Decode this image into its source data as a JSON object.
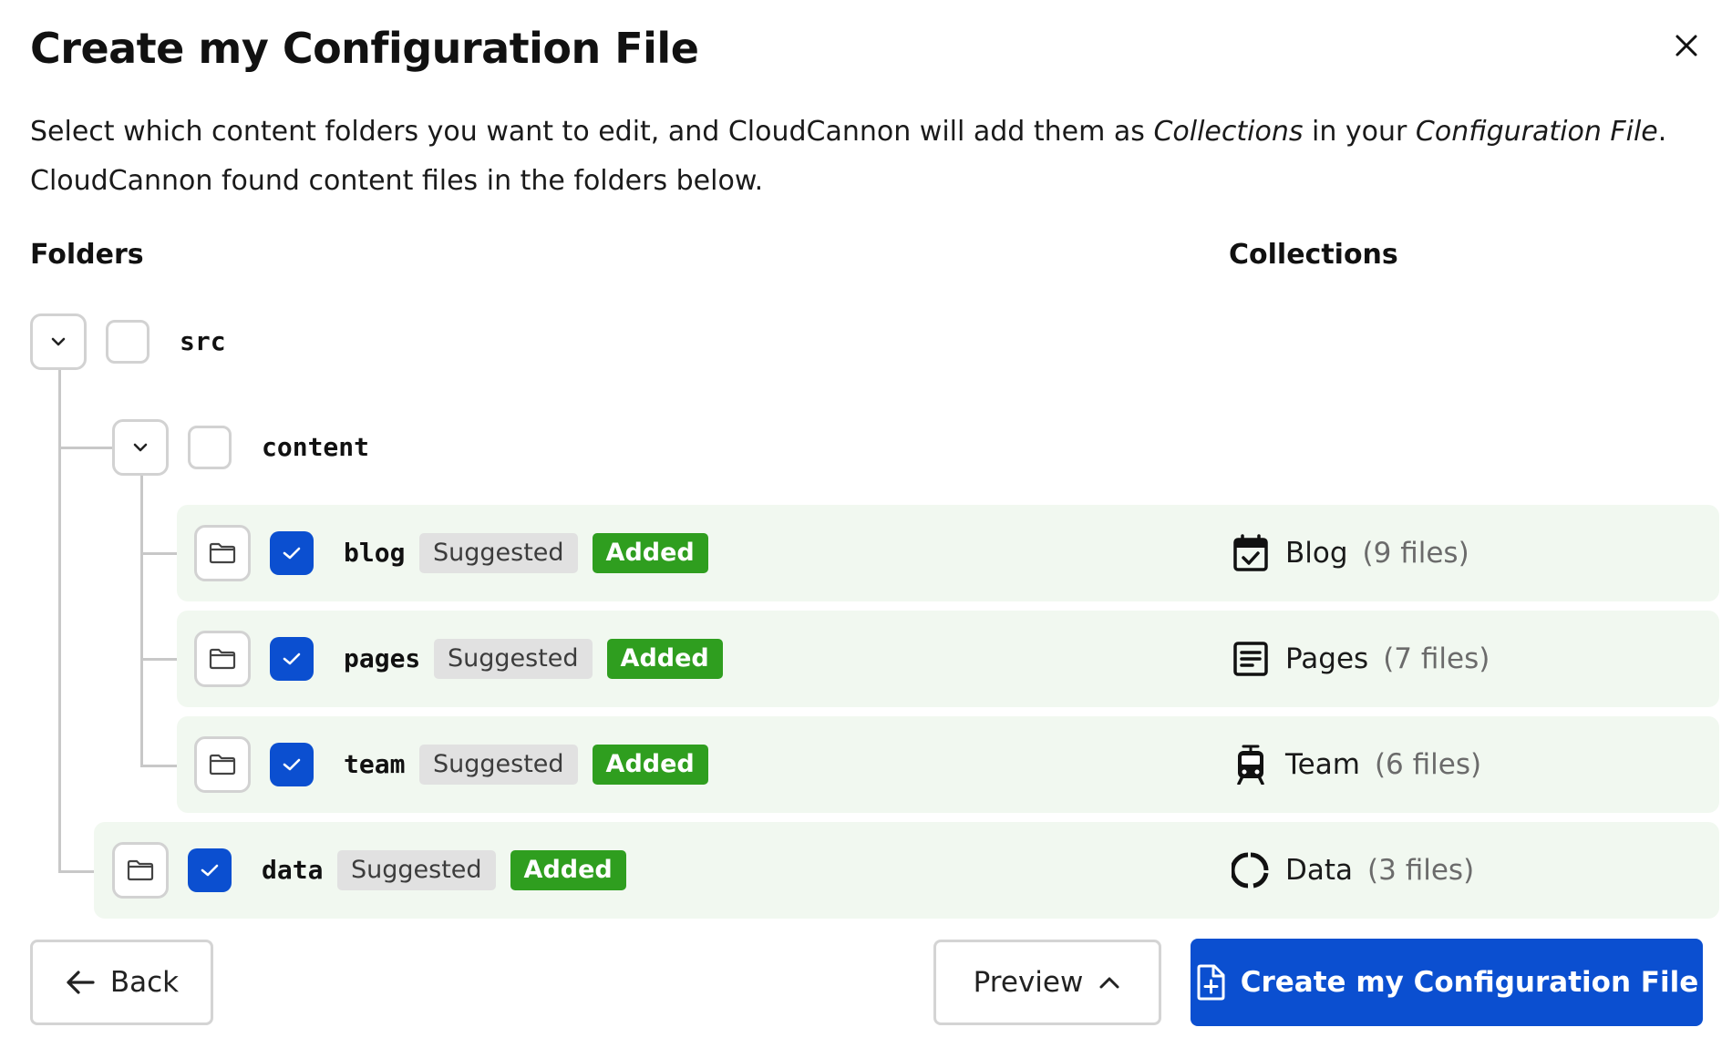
{
  "dialog": {
    "title": "Create my Configuration File",
    "description": {
      "part1": "Select which content folders you want to edit, and CloudCannon will add them as ",
      "em1": "Collections",
      "part2": " in your ",
      "em2": "Configuration File",
      "part3": ".",
      "line2": "CloudCannon found content files in the folders below."
    }
  },
  "columns": {
    "folders": "Folders",
    "collections": "Collections"
  },
  "tree": {
    "src": {
      "name": "src",
      "checked": false,
      "expanded": true
    },
    "content": {
      "name": "content",
      "checked": false,
      "expanded": true
    },
    "rows": [
      {
        "name": "blog",
        "suggested": "Suggested",
        "added": "Added",
        "checked": true,
        "collection": "Blog",
        "count": "(9 files)",
        "icon": "calendar-check-icon"
      },
      {
        "name": "pages",
        "suggested": "Suggested",
        "added": "Added",
        "checked": true,
        "collection": "Pages",
        "count": "(7 files)",
        "icon": "article-icon"
      },
      {
        "name": "team",
        "suggested": "Suggested",
        "added": "Added",
        "checked": true,
        "collection": "Team",
        "count": "(6 files)",
        "icon": "tram-icon"
      },
      {
        "name": "data",
        "suggested": "Suggested",
        "added": "Added",
        "checked": true,
        "collection": "Data",
        "count": "(3 files)",
        "icon": "donut-icon"
      }
    ]
  },
  "footer": {
    "back_label": "Back",
    "preview_label": "Preview",
    "create_label": "Create my Configuration File"
  },
  "colors": {
    "primary": "#0b4fd0",
    "added_badge": "#2f9e1f",
    "suggested_badge": "#e1e1e1",
    "row_highlight": "#f1f8f0",
    "muted_text": "#6b6b6b"
  }
}
